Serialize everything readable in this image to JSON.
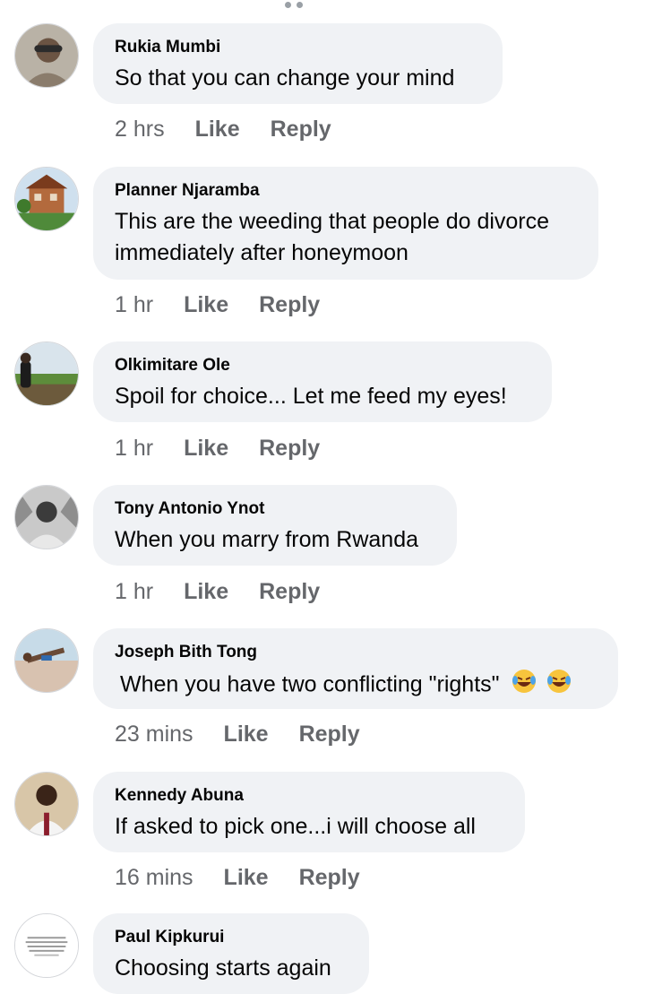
{
  "comments": [
    {
      "author": "Rukia Mumbi",
      "text": "So that you can change your mind",
      "time": "2 hrs",
      "like": "Like",
      "reply": "Reply"
    },
    {
      "author": "Planner Njaramba",
      "text": "This are the weeding that people do divorce",
      "text2": "immediately after honeymoon",
      "time": "1 hr",
      "like": "Like",
      "reply": "Reply"
    },
    {
      "author": "Olkimitare Ole",
      "text": "Spoil for choice... Let me feed my eyes!",
      "time": "1 hr",
      "like": "Like",
      "reply": "Reply"
    },
    {
      "author": "Tony Antonio Ynot",
      "text": "When you marry from Rwanda",
      "time": "1 hr",
      "like": "Like",
      "reply": "Reply"
    },
    {
      "author": "Joseph Bith Tong",
      "text": "When you have two conflicting \"rights\"",
      "time": "23 mins",
      "like": "Like",
      "reply": "Reply"
    },
    {
      "author": "Kennedy Abuna",
      "text": "If asked to pick one...i will choose all",
      "time": "16 mins",
      "like": "Like",
      "reply": "Reply"
    },
    {
      "author": "Paul Kipkurui",
      "text": "Choosing starts again"
    }
  ],
  "colors": {
    "bubble": "#f0f2f5",
    "meta": "#65676b",
    "text": "#050505"
  }
}
